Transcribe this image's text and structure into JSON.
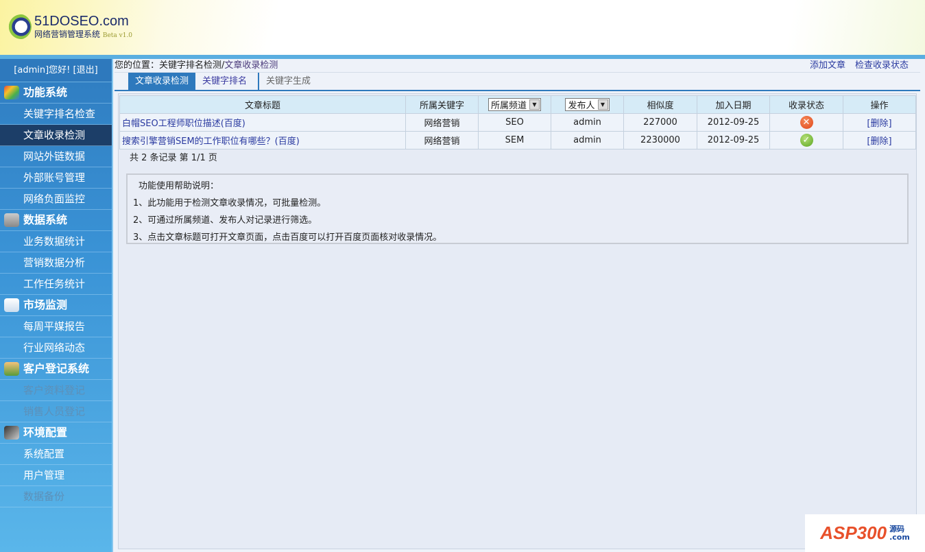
{
  "header": {
    "logo_title": "51DOSEO.com",
    "logo_subtitle": "网络营销管理系统",
    "logo_version": "Beta v1.0"
  },
  "sidebar": {
    "user_greeting": "[admin]您好!",
    "logout": "[退出]",
    "groups": [
      {
        "label": "功能系统",
        "icon": "diamond-icon",
        "items": [
          {
            "label": "关键字排名检查"
          },
          {
            "label": "文章收录检测",
            "selected": true
          },
          {
            "label": "网站外链数据"
          },
          {
            "label": "外部账号管理"
          },
          {
            "label": "网络负面监控"
          }
        ]
      },
      {
        "label": "数据系统",
        "icon": "database-icon",
        "items": [
          {
            "label": "业务数据统计"
          },
          {
            "label": "营销数据分析"
          },
          {
            "label": "工作任务统计"
          }
        ]
      },
      {
        "label": "市场监测",
        "icon": "report-icon",
        "items": [
          {
            "label": "每周平媒报告"
          },
          {
            "label": "行业网络动态"
          }
        ]
      },
      {
        "label": "客户登记系统",
        "icon": "users-icon",
        "items": [
          {
            "label": "客户资料登记",
            "disabled": true
          },
          {
            "label": "销售人员登记",
            "disabled": true
          }
        ]
      },
      {
        "label": "环境配置",
        "icon": "tools-icon",
        "items": [
          {
            "label": "系统配置"
          },
          {
            "label": "用户管理"
          },
          {
            "label": "数据备份",
            "disabled": true
          }
        ]
      }
    ]
  },
  "breadcrumb": {
    "prefix": "您的位置：关键字排名检测/",
    "current": "文章收录检测"
  },
  "actions": {
    "add": "添加文章",
    "check": "检查收录状态"
  },
  "tabs": [
    "文章收录检测",
    "关键字排名",
    "关键字生成"
  ],
  "table": {
    "headers": {
      "title": "文章标题",
      "keyword": "所属关键字",
      "channel": "所属频道",
      "publisher": "发布人",
      "similarity": "相似度",
      "date": "加入日期",
      "status": "收录状态",
      "op": "操作"
    },
    "rows": [
      {
        "title": "白帽SEO工程师职位描述(百度)",
        "keyword": "网络营销",
        "channel": "SEO",
        "publisher": "admin",
        "similarity": "227000",
        "date": "2012-09-25",
        "status": "未收录",
        "op": "[删除]"
      },
      {
        "title": "搜索引擎营销SEM的工作职位有哪些？(百度)",
        "keyword": "网络营销",
        "channel": "SEM",
        "publisher": "admin",
        "similarity": "2230000",
        "date": "2012-09-25",
        "status": "已收录",
        "op": "[删除]"
      }
    ]
  },
  "pagination": "共 2 条记录 第 1/1 页",
  "help": {
    "title": "功能使用帮助说明：",
    "lines": [
      "1、此功能用于检测文章收录情况，可批量检测。",
      "2、可通过所属频道、发布人对记录进行筛选。",
      "3、点击文章标题可打开文章页面，点击百度可以打开百度页面核对收录情况。"
    ]
  },
  "watermark": {
    "text": "ASP300",
    "sub1": "源码",
    "sub2": ".com"
  }
}
